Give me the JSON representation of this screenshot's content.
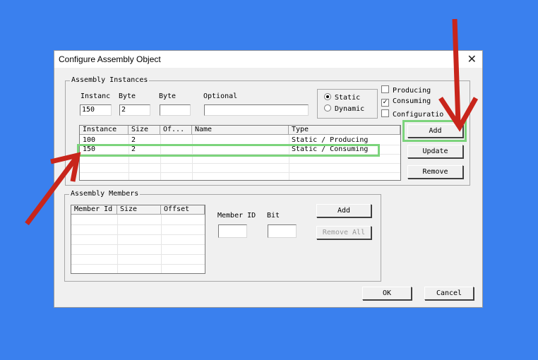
{
  "dialog": {
    "title": "Configure Assembly Object",
    "close_glyph": "✕"
  },
  "instances": {
    "group_label": "Assembly Instances",
    "labels": {
      "instance": "Instanc",
      "byte1": "Byte",
      "byte2": "Byte",
      "optional": "Optional"
    },
    "values": {
      "instance": "150",
      "byte1": "2",
      "byte2": "",
      "optional": ""
    },
    "radio": {
      "static": "Static",
      "dynamic": "Dynamic",
      "selected": "static"
    },
    "checks": {
      "producing": {
        "label": "Producing",
        "checked": false
      },
      "consuming": {
        "label": "Consuming",
        "checked": true
      },
      "configuration": {
        "label": "Configuratio",
        "checked": false
      }
    },
    "columns": [
      "Instance",
      "Size",
      "Of...",
      "Name",
      "Type"
    ],
    "rows": [
      [
        "100",
        "2",
        "",
        "",
        "Static / Producing"
      ],
      [
        "150",
        "2",
        "",
        "",
        "Static / Consuming"
      ]
    ],
    "buttons": {
      "add": "Add",
      "update": "Update",
      "remove": "Remove"
    }
  },
  "members": {
    "group_label": "Assembly Members",
    "columns": [
      "Member Id",
      "Size",
      "Offset"
    ],
    "labels": {
      "member_id": "Member ID",
      "bit": "Bit"
    },
    "values": {
      "member_id": "",
      "bit": ""
    },
    "buttons": {
      "add": "Add",
      "remove_all": "Remove All"
    }
  },
  "footer": {
    "ok": "OK",
    "cancel": "Cancel"
  },
  "colors": {
    "background": "#3a80ee",
    "highlight": "#7cd47c",
    "arrow": "#c8251b"
  },
  "check_glyph": "✓"
}
